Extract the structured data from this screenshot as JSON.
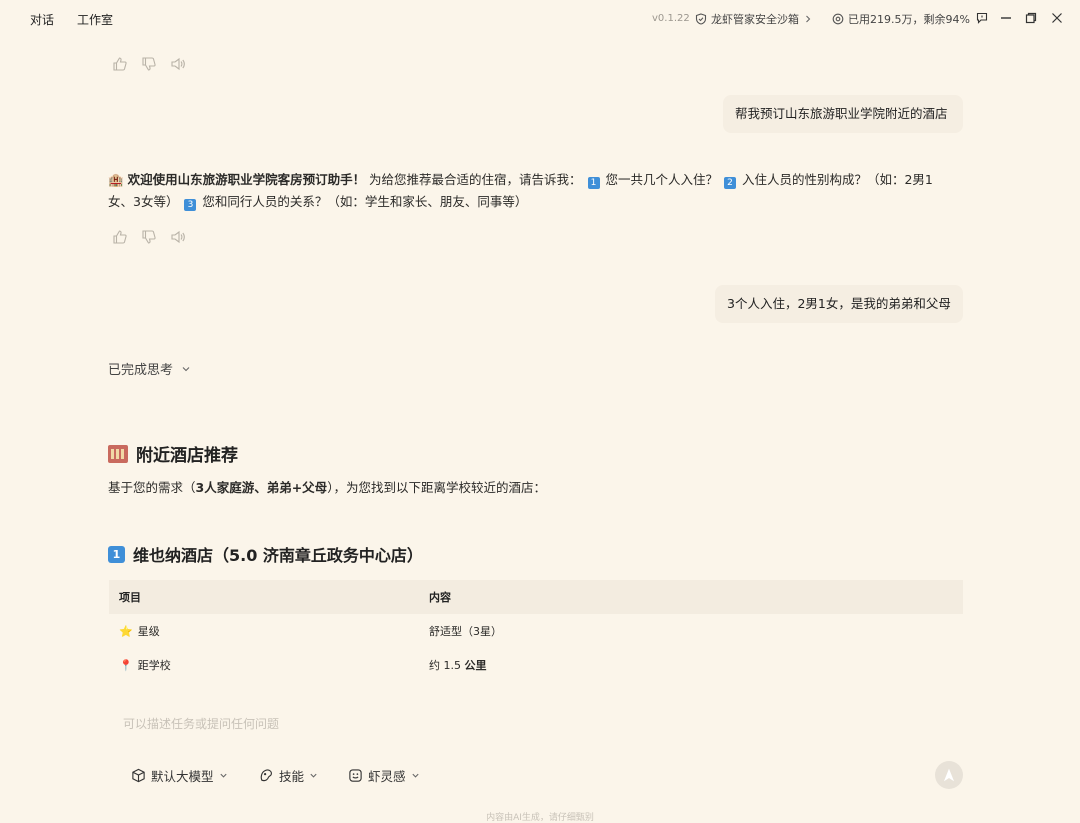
{
  "topbar": {
    "tabs": [
      "对话",
      "工作室"
    ],
    "version": "v0.1.22",
    "sandbox_label": "龙虾管家安全沙箱",
    "usage_label": "已用219.5万，剩余94%"
  },
  "messages": {
    "user_1": "帮我预订山东旅游职业学院附近的酒店",
    "assistant_1": {
      "intro_emoji": "🏨",
      "bold": "欢迎使用山东旅游职业学院客房预订助手！",
      "text_a": " 为给您推荐最合适的住宿，请告诉我： ",
      "n1": "1",
      "q1": " 您一共几个人入住？ ",
      "n2": "2",
      "q2": " 入住人员的性别构成？（如：2男1女、3女等） ",
      "n3": "3",
      "q3": " 您和同行人员的关系？（如：学生和家长、朋友、同事等）"
    },
    "user_2": "3个人入住，2男1女，是我的弟弟和父母",
    "thinking_label": "已完成思考"
  },
  "section": {
    "title": "附近酒店推荐",
    "para_prefix": "基于您的需求（",
    "para_bold": "3人家庭游、弟弟+父母",
    "para_suffix": "），为您找到以下距离学校较近的酒店：",
    "hotel_num": "1",
    "hotel_title": "维也纳酒店（5.0 济南章丘政务中心店）"
  },
  "table": {
    "headers": [
      "项目",
      "内容"
    ],
    "rows": [
      {
        "icon": "⭐",
        "label": "星级",
        "value": "舒适型（3星）",
        "value_bold": ""
      },
      {
        "icon": "📍",
        "label": "距学校",
        "value": "约 1.5 ",
        "value_bold": "公里"
      }
    ]
  },
  "input": {
    "placeholder": "可以描述任务或提问任何问题",
    "model_label": "默认大模型",
    "skills_label": "技能",
    "inspiration_label": "虾灵感"
  },
  "footer": "内容由AI生成，请仔细甄别",
  "colors": {
    "background": "#fbf5ea",
    "number_badge": "#3f8fd8",
    "bubble": "#f5eee2"
  }
}
